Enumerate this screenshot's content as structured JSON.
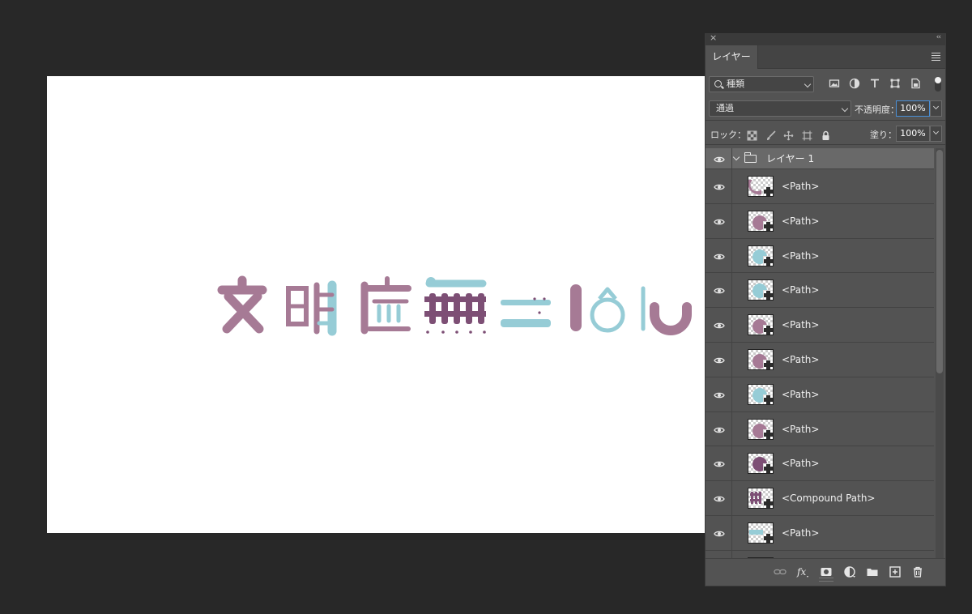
{
  "panel": {
    "close_icon": "close-icon",
    "collapse_icon": "collapse-icon",
    "tab_label": "レイヤー",
    "menu_icon": "panel-menu-icon"
  },
  "filter": {
    "kind_label": "種類",
    "filter_icons": [
      "image-filter-icon",
      "adjustment-filter-icon",
      "type-filter-icon",
      "shape-filter-icon",
      "smart-object-filter-icon"
    ],
    "toggle": "on"
  },
  "blend": {
    "mode": "通過",
    "opacity_label": "不透明度：",
    "opacity_value": "100%"
  },
  "lock": {
    "label": "ロック：",
    "icons": [
      "lock-transparent-icon",
      "lock-paint-icon",
      "lock-position-icon",
      "lock-artboard-icon",
      "lock-all-icon"
    ],
    "fill_label": "塗り：",
    "fill_value": "100%"
  },
  "layers": {
    "group": {
      "name": "レイヤー 1",
      "expanded": true
    },
    "items": [
      {
        "name": "<Path>",
        "thumb": "mauve-crescent"
      },
      {
        "name": "<Path>",
        "thumb": "mauve-circle"
      },
      {
        "name": "<Path>",
        "thumb": "teal-circle"
      },
      {
        "name": "<Path>",
        "thumb": "teal-circle"
      },
      {
        "name": "<Path>",
        "thumb": "mauve-circle"
      },
      {
        "name": "<Path>",
        "thumb": "mauve-circle"
      },
      {
        "name": "<Path>",
        "thumb": "teal-circle"
      },
      {
        "name": "<Path>",
        "thumb": "mauve-circle"
      },
      {
        "name": "<Path>",
        "thumb": "plum-circle"
      },
      {
        "name": "<Compound Path>",
        "thumb": "plum-fence"
      },
      {
        "name": "<Path>",
        "thumb": "teal-bar"
      },
      {
        "name": "",
        "thumb": "teal-partial"
      }
    ]
  },
  "bottom_icons": [
    "link-layers-icon",
    "fx-icon",
    "mask-icon",
    "adjustment-layer-icon",
    "new-group-icon",
    "new-layer-icon",
    "trash-icon"
  ],
  "colors": {
    "mauve": "#a67a95",
    "plum": "#7d4f75",
    "teal": "#96ccd6",
    "panel_bg": "#535353",
    "app_bg": "#282828"
  }
}
